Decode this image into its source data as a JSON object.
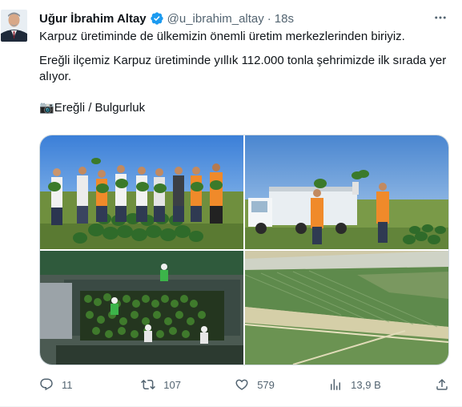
{
  "author": {
    "name": "Uğur İbrahim Altay",
    "handle": "@u_ibrahim_altay",
    "separator": "·",
    "time": "18s"
  },
  "tweet": {
    "line1": "Karpuz üretiminde de ülkemizin önemli üretim merkezlerinden biriyiz.",
    "line2": "Ereğli ilçemiz Karpuz üretiminde yıllık 112.000 tonla şehrimizde ilk sırada yer alıyor.",
    "line3_emoji": "📷",
    "line3": "Ereğli / Bulgurluk"
  },
  "actions": {
    "replies": "11",
    "retweets": "107",
    "likes": "579",
    "views": "13,9 B"
  },
  "colors": {
    "text": "#0f1419",
    "secondary": "#536471",
    "verified": "#1d9bf0",
    "border": "#cfd9de"
  },
  "icons": [
    "verified-badge-icon",
    "more-icon",
    "reply-icon",
    "retweet-icon",
    "like-icon",
    "views-icon",
    "share-icon",
    "camera-icon"
  ]
}
